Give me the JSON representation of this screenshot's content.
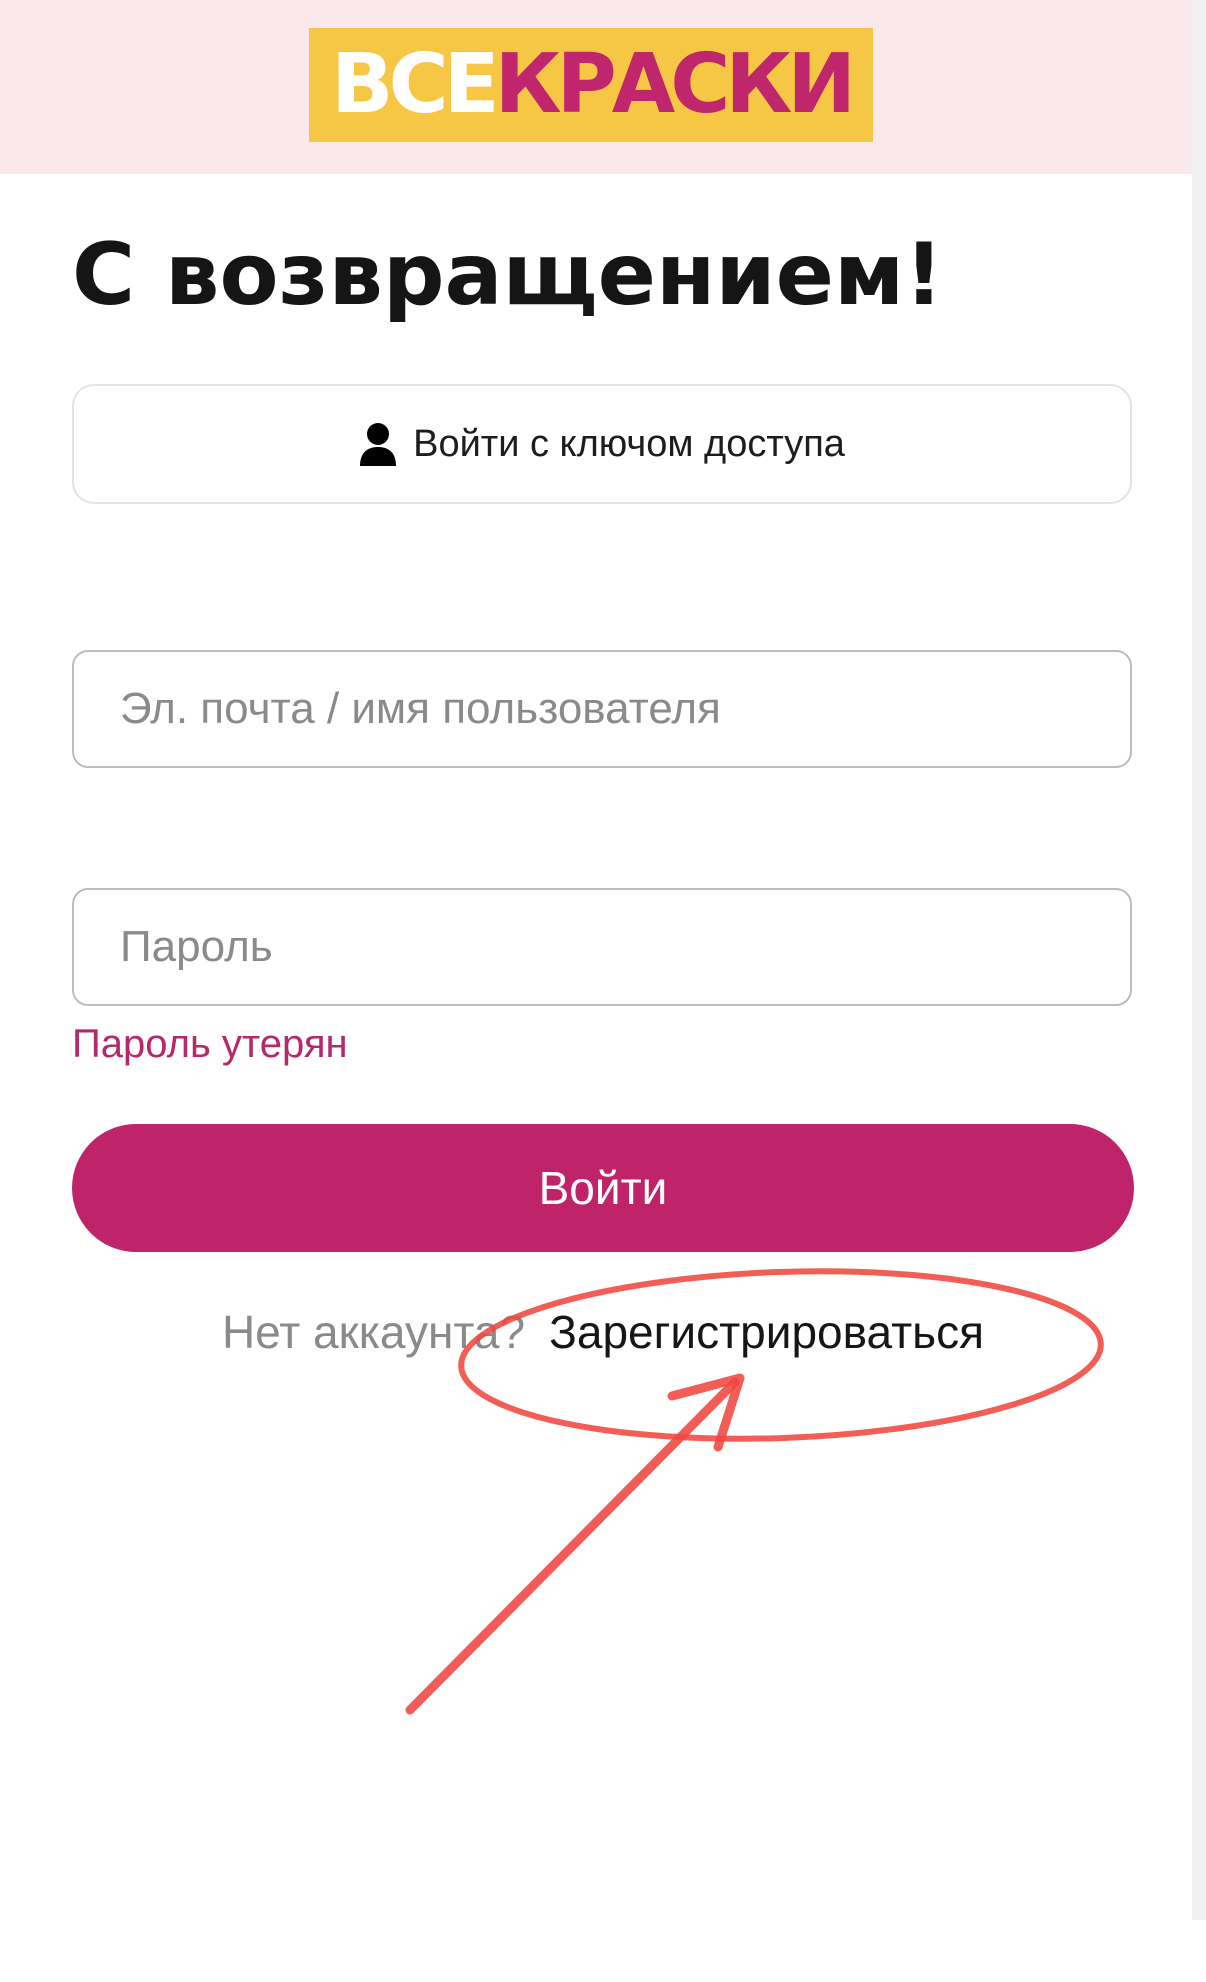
{
  "header": {
    "logo_part_1": "ВСЕ",
    "logo_part_2": "КРАСКИ"
  },
  "page": {
    "title": "С возвращением!"
  },
  "login_form": {
    "passkey_button_label": "Войти с ключом доступа",
    "username_placeholder": "Эл. почта / имя пользователя",
    "username_value": "",
    "password_placeholder": "Пароль",
    "password_value": "",
    "forgot_password_label": "Пароль утерян",
    "submit_label": "Войти",
    "no_account_text": "Нет аккаунта?",
    "signup_label": "Зарегистрироваться"
  },
  "colors": {
    "brand_primary": "#bf246a",
    "logo_background": "#f6c744",
    "header_background": "#fbe8ec",
    "annotation_red": "#f0473f"
  },
  "icons": {
    "passkey": "user-icon"
  }
}
